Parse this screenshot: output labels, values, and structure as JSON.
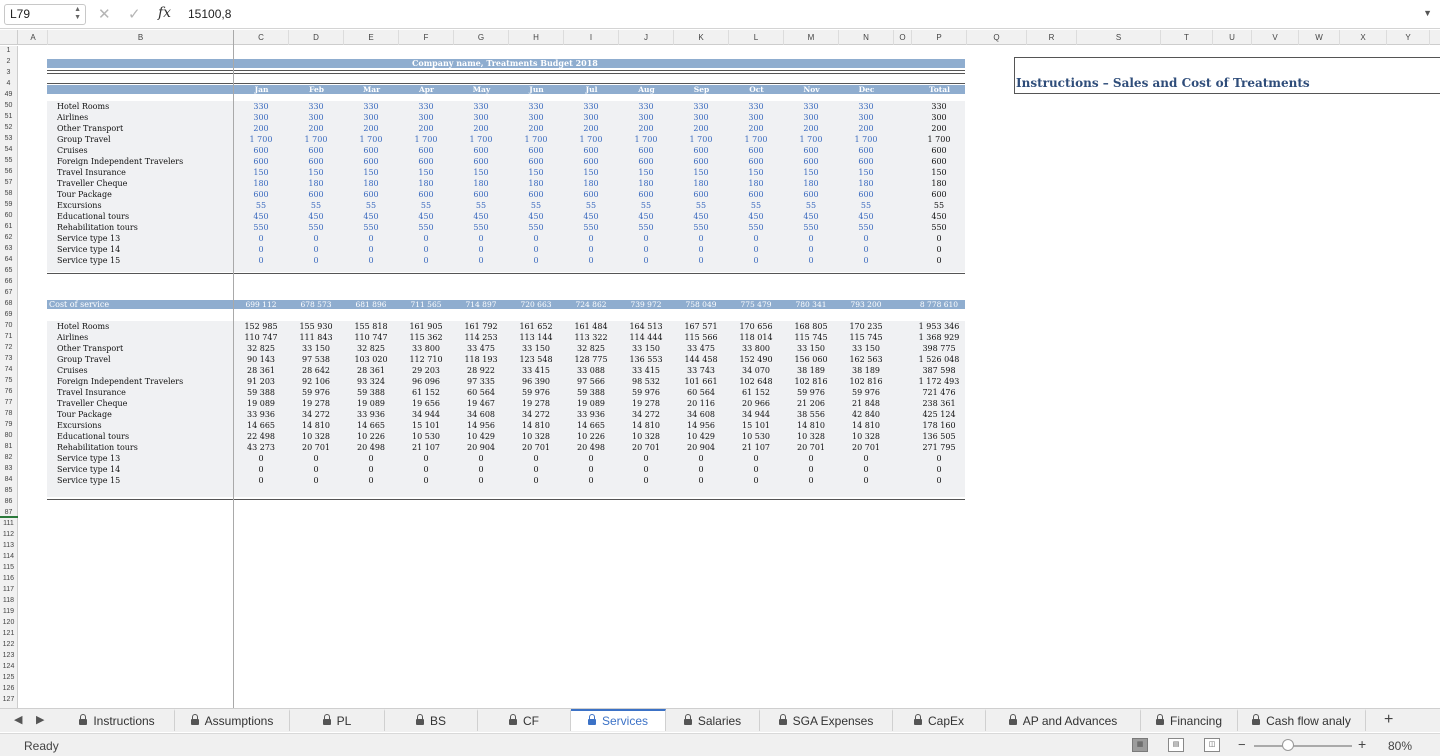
{
  "formula_bar": {
    "name_box": "L79",
    "formula_value": "15100,8",
    "fx_label": "fx"
  },
  "columns": [
    {
      "l": "A",
      "w": 29
    },
    {
      "l": "B",
      "w": 186
    },
    {
      "l": "C",
      "w": 55
    },
    {
      "l": "D",
      "w": 55
    },
    {
      "l": "E",
      "w": 55
    },
    {
      "l": "F",
      "w": 55
    },
    {
      "l": "G",
      "w": 55
    },
    {
      "l": "H",
      "w": 55
    },
    {
      "l": "I",
      "w": 55
    },
    {
      "l": "J",
      "w": 55
    },
    {
      "l": "K",
      "w": 55
    },
    {
      "l": "L",
      "w": 55
    },
    {
      "l": "M",
      "w": 55
    },
    {
      "l": "N",
      "w": 55
    },
    {
      "l": "O",
      "w": 18
    },
    {
      "l": "P",
      "w": 55
    },
    {
      "l": "Q",
      "w": 60
    },
    {
      "l": "R",
      "w": 50
    },
    {
      "l": "S",
      "w": 84
    },
    {
      "l": "T",
      "w": 52
    },
    {
      "l": "U",
      "w": 39
    },
    {
      "l": "V",
      "w": 47
    },
    {
      "l": "W",
      "w": 41
    },
    {
      "l": "X",
      "w": 47
    },
    {
      "l": "Y",
      "w": 43
    }
  ],
  "rows": [
    "1",
    "2",
    "3",
    "4",
    "49",
    "50",
    "51",
    "52",
    "53",
    "54",
    "55",
    "56",
    "57",
    "58",
    "59",
    "60",
    "61",
    "62",
    "63",
    "64",
    "65",
    "66",
    "67",
    "68",
    "69",
    "70",
    "71",
    "72",
    "73",
    "74",
    "75",
    "76",
    "77",
    "78",
    "79",
    "80",
    "81",
    "82",
    "83",
    "84",
    "85",
    "86",
    "87",
    "111",
    "112",
    "113",
    "114",
    "115",
    "116",
    "117",
    "118",
    "119",
    "120",
    "121",
    "122",
    "123",
    "124",
    "125",
    "126",
    "127"
  ],
  "sheet": {
    "title": "Company name, Treatments Budget 2018",
    "months": [
      "Jan",
      "Feb",
      "Mar",
      "Apr",
      "May",
      "Jun",
      "Jul",
      "Aug",
      "Sep",
      "Oct",
      "Nov",
      "Dec"
    ],
    "total_label": "Total",
    "services": [
      "Hotel Rooms",
      "Airlines",
      "Other Transport",
      "Group Travel",
      "Cruises",
      "Foreign Independent Travelers",
      "Travel Insurance",
      "Traveller Cheque",
      "Tour Package",
      "Excursions",
      "Educational tours",
      "Rehabilitation tours",
      "Service type 13",
      "Service type 14",
      "Service type 15"
    ],
    "prices": [
      [
        "330",
        "330",
        "330",
        "330",
        "330",
        "330",
        "330",
        "330",
        "330",
        "330",
        "330",
        "330",
        "330"
      ],
      [
        "300",
        "300",
        "300",
        "300",
        "300",
        "300",
        "300",
        "300",
        "300",
        "300",
        "300",
        "300",
        "300"
      ],
      [
        "200",
        "200",
        "200",
        "200",
        "200",
        "200",
        "200",
        "200",
        "200",
        "200",
        "200",
        "200",
        "200"
      ],
      [
        "1 700",
        "1 700",
        "1 700",
        "1 700",
        "1 700",
        "1 700",
        "1 700",
        "1 700",
        "1 700",
        "1 700",
        "1 700",
        "1 700",
        "1 700"
      ],
      [
        "600",
        "600",
        "600",
        "600",
        "600",
        "600",
        "600",
        "600",
        "600",
        "600",
        "600",
        "600",
        "600"
      ],
      [
        "600",
        "600",
        "600",
        "600",
        "600",
        "600",
        "600",
        "600",
        "600",
        "600",
        "600",
        "600",
        "600"
      ],
      [
        "150",
        "150",
        "150",
        "150",
        "150",
        "150",
        "150",
        "150",
        "150",
        "150",
        "150",
        "150",
        "150"
      ],
      [
        "180",
        "180",
        "180",
        "180",
        "180",
        "180",
        "180",
        "180",
        "180",
        "180",
        "180",
        "180",
        "180"
      ],
      [
        "600",
        "600",
        "600",
        "600",
        "600",
        "600",
        "600",
        "600",
        "600",
        "600",
        "600",
        "600",
        "600"
      ],
      [
        "55",
        "55",
        "55",
        "55",
        "55",
        "55",
        "55",
        "55",
        "55",
        "55",
        "55",
        "55",
        "55"
      ],
      [
        "450",
        "450",
        "450",
        "450",
        "450",
        "450",
        "450",
        "450",
        "450",
        "450",
        "450",
        "450",
        "450"
      ],
      [
        "550",
        "550",
        "550",
        "550",
        "550",
        "550",
        "550",
        "550",
        "550",
        "550",
        "550",
        "550",
        "550"
      ],
      [
        "0",
        "0",
        "0",
        "0",
        "0",
        "0",
        "0",
        "0",
        "0",
        "0",
        "0",
        "0",
        "0"
      ],
      [
        "0",
        "0",
        "0",
        "0",
        "0",
        "0",
        "0",
        "0",
        "0",
        "0",
        "0",
        "0",
        "0"
      ],
      [
        "0",
        "0",
        "0",
        "0",
        "0",
        "0",
        "0",
        "0",
        "0",
        "0",
        "0",
        "0",
        "0"
      ]
    ],
    "cost_label": "Cost of service",
    "cost_totals": [
      "699 112",
      "678 573",
      "681 896",
      "711 565",
      "714 897",
      "720 663",
      "724 862",
      "739 972",
      "758 049",
      "775 479",
      "780 341",
      "793 200",
      "8 778 610"
    ],
    "costs": [
      [
        "152 985",
        "155 930",
        "155 818",
        "161 905",
        "161 792",
        "161 652",
        "161 484",
        "164 513",
        "167 571",
        "170 656",
        "168 805",
        "170 235",
        "1 953 346"
      ],
      [
        "110 747",
        "111 843",
        "110 747",
        "115 362",
        "114 253",
        "113 144",
        "113 322",
        "114 444",
        "115 566",
        "118 014",
        "115 745",
        "115 745",
        "1 368 929"
      ],
      [
        "32 825",
        "33 150",
        "32 825",
        "33 800",
        "33 475",
        "33 150",
        "32 825",
        "33 150",
        "33 475",
        "33 800",
        "33 150",
        "33 150",
        "398 775"
      ],
      [
        "90 143",
        "97 538",
        "103 020",
        "112 710",
        "118 193",
        "123 548",
        "128 775",
        "136 553",
        "144 458",
        "152 490",
        "156 060",
        "162 563",
        "1 526 048"
      ],
      [
        "28 361",
        "28 642",
        "28 361",
        "29 203",
        "28 922",
        "33 415",
        "33 088",
        "33 415",
        "33 743",
        "34 070",
        "38 189",
        "38 189",
        "387 598"
      ],
      [
        "91 203",
        "92 106",
        "93 324",
        "96 096",
        "97 335",
        "96 390",
        "97 566",
        "98 532",
        "101 661",
        "102 648",
        "102 816",
        "102 816",
        "1 172 493"
      ],
      [
        "59 388",
        "59 976",
        "59 388",
        "61 152",
        "60 564",
        "59 976",
        "59 388",
        "59 976",
        "60 564",
        "61 152",
        "59 976",
        "59 976",
        "721 476"
      ],
      [
        "19 089",
        "19 278",
        "19 089",
        "19 656",
        "19 467",
        "19 278",
        "19 089",
        "19 278",
        "20 116",
        "20 966",
        "21 206",
        "21 848",
        "238 361"
      ],
      [
        "33 936",
        "34 272",
        "33 936",
        "34 944",
        "34 608",
        "34 272",
        "33 936",
        "34 272",
        "34 608",
        "34 944",
        "38 556",
        "42 840",
        "425 124"
      ],
      [
        "14 665",
        "14 810",
        "14 665",
        "15 101",
        "14 956",
        "14 810",
        "14 665",
        "14 810",
        "14 956",
        "15 101",
        "14 810",
        "14 810",
        "178 160"
      ],
      [
        "22 498",
        "10 328",
        "10 226",
        "10 530",
        "10 429",
        "10 328",
        "10 226",
        "10 328",
        "10 429",
        "10 530",
        "10 328",
        "10 328",
        "136 505"
      ],
      [
        "43 273",
        "20 701",
        "20 498",
        "21 107",
        "20 904",
        "20 701",
        "20 498",
        "20 701",
        "20 904",
        "21 107",
        "20 701",
        "20 701",
        "271 795"
      ],
      [
        "0",
        "0",
        "0",
        "0",
        "0",
        "0",
        "0",
        "0",
        "0",
        "0",
        "0",
        "0",
        "0"
      ],
      [
        "0",
        "0",
        "0",
        "0",
        "0",
        "0",
        "0",
        "0",
        "0",
        "0",
        "0",
        "0",
        "0"
      ],
      [
        "0",
        "0",
        "0",
        "0",
        "0",
        "0",
        "0",
        "0",
        "0",
        "0",
        "0",
        "0",
        "0"
      ]
    ],
    "instructions_title": "Instructions – Sales and Cost of Treatments"
  },
  "tabs": [
    {
      "label": "Instructions",
      "w": 115
    },
    {
      "label": "Assumptions",
      "w": 115
    },
    {
      "label": "PL",
      "w": 95
    },
    {
      "label": "BS",
      "w": 93
    },
    {
      "label": "CF",
      "w": 93
    },
    {
      "label": "Services",
      "w": 95,
      "active": true
    },
    {
      "label": "Salaries",
      "w": 94
    },
    {
      "label": "SGA Expenses",
      "w": 133
    },
    {
      "label": "CapEx",
      "w": 93
    },
    {
      "label": "AP and Advances",
      "w": 155
    },
    {
      "label": "Financing",
      "w": 97
    },
    {
      "label": "Cash flow analy",
      "w": 128
    }
  ],
  "status": {
    "text": "Ready",
    "zoom": "80%",
    "zoom_fraction": 0.35
  }
}
